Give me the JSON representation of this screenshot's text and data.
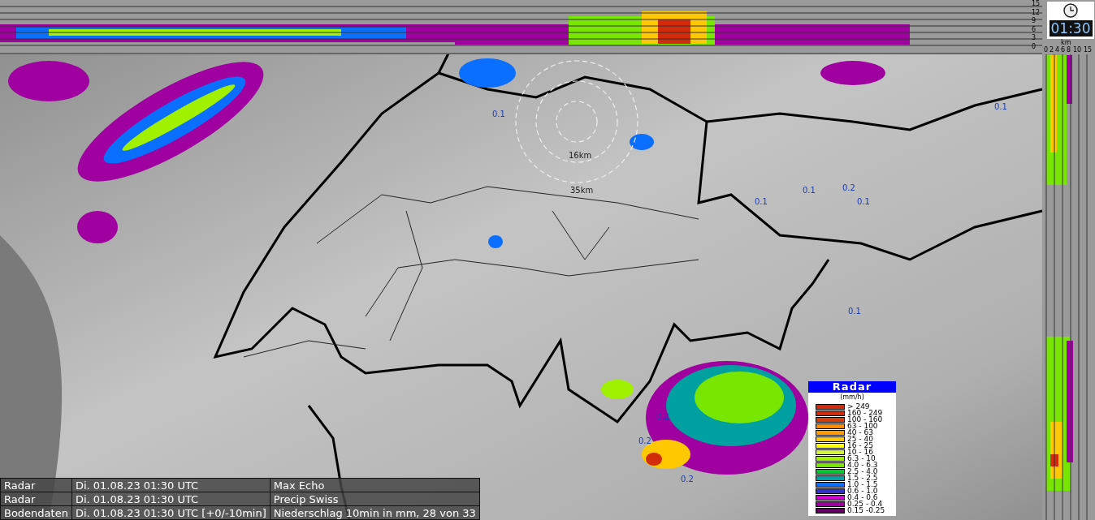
{
  "time_display": {
    "time": "01:30"
  },
  "profile_axis": {
    "height_ticks": [
      "15",
      "12",
      "9",
      "6",
      "3",
      "0"
    ],
    "unit": "km",
    "distance_ticks": [
      "0",
      "2",
      "4",
      "6",
      "8",
      "10",
      "15"
    ]
  },
  "range_rings": [
    {
      "label": "16km"
    },
    {
      "label": "35km"
    }
  ],
  "map_values": [
    {
      "text": "0.1"
    },
    {
      "text": "0.1"
    },
    {
      "text": "0.1"
    },
    {
      "text": "0.1"
    },
    {
      "text": "0.2"
    },
    {
      "text": "0.1"
    },
    {
      "text": "0.1"
    },
    {
      "text": "0.2"
    },
    {
      "text": "0.2"
    },
    {
      "text": "0.2"
    }
  ],
  "legend": {
    "title": "Radar",
    "unit": "(mm/h)",
    "classes": [
      {
        "label": "> 249",
        "color": "#d22a0a"
      },
      {
        "label": "160 - 249",
        "color": "#d22a0a"
      },
      {
        "label": "100 - 160",
        "color": "#d63c0c"
      },
      {
        "label": "63 - 100",
        "color": "#ff8c00"
      },
      {
        "label": "40 - 63",
        "color": "#ff9a00"
      },
      {
        "label": "25 - 40",
        "color": "#ffc800"
      },
      {
        "label": "16 - 25",
        "color": "#ffff00"
      },
      {
        "label": "10 - 16",
        "color": "#d2f53c"
      },
      {
        "label": "6.3 - 10",
        "color": "#a0f000"
      },
      {
        "label": "4.0 - 6.3",
        "color": "#78e600"
      },
      {
        "label": "2.5 - 4.0",
        "color": "#00c832"
      },
      {
        "label": "1.5 - 2.5",
        "color": "#00a0a0"
      },
      {
        "label": "1.0 - 1.5",
        "color": "#0a6eff"
      },
      {
        "label": "0.6 - 1.0",
        "color": "#3232c8"
      },
      {
        "label": "0.4 - 0.6",
        "color": "#d200d2"
      },
      {
        "label": "0.25 - 0.4",
        "color": "#a000a0"
      },
      {
        "label": "0.15 -0.25",
        "color": "#640064"
      }
    ]
  },
  "info_table": {
    "rows": [
      {
        "source": "Radar",
        "time": "Di. 01.08.23 01:30 UTC",
        "product": "Max Echo"
      },
      {
        "source": "Radar",
        "time": "Di. 01.08.23 01:30 UTC",
        "product": "Precip Swiss"
      },
      {
        "source": "Bodendaten",
        "time": "Di. 01.08.23 01:30 UTC [+0/-10min]",
        "product": "Niederschlag 10min in mm, 28 von 33"
      }
    ]
  }
}
